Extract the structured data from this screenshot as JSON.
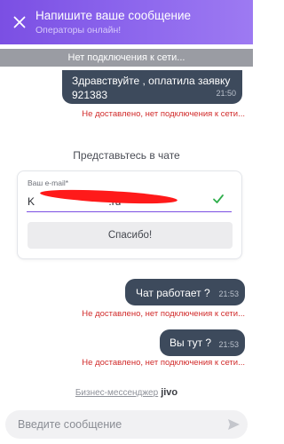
{
  "header": {
    "title": "Напишите ваше сообщение",
    "subtitle": "Операторы онлайн!"
  },
  "connection_banner": "Нет подключения к сети...",
  "messages": [
    {
      "text": "Здравствуйте , оплатила заявку 921383",
      "time": "21:50",
      "status": "Не доставлено, нет подключения к сети..."
    },
    {
      "text": "Чат работает ?",
      "time": "21:53",
      "status": "Не доставлено, нет подключения к сети..."
    },
    {
      "text": "Вы тут ?",
      "time": "21:53",
      "status": "Не доставлено, нет подключения к сети..."
    }
  ],
  "intro_form": {
    "title": "Представьтесь в чате",
    "email_label": "Ваш e-mail*",
    "email_value": "K                         .ru",
    "submit_label": "Спасибо!"
  },
  "branding": {
    "text": "Бизнес-мессенджер",
    "logo": "jivo"
  },
  "composer": {
    "placeholder": "Введите сообщение"
  },
  "icons": {
    "close": "close-icon",
    "check": "check-icon",
    "send": "send-icon"
  },
  "colors": {
    "header_start": "#7b4fe3",
    "header_end": "#9d7af2",
    "bubble": "#3d4a5c",
    "error": "#d12b2b",
    "accent": "#7b4fe3",
    "check": "#2fae4b"
  }
}
